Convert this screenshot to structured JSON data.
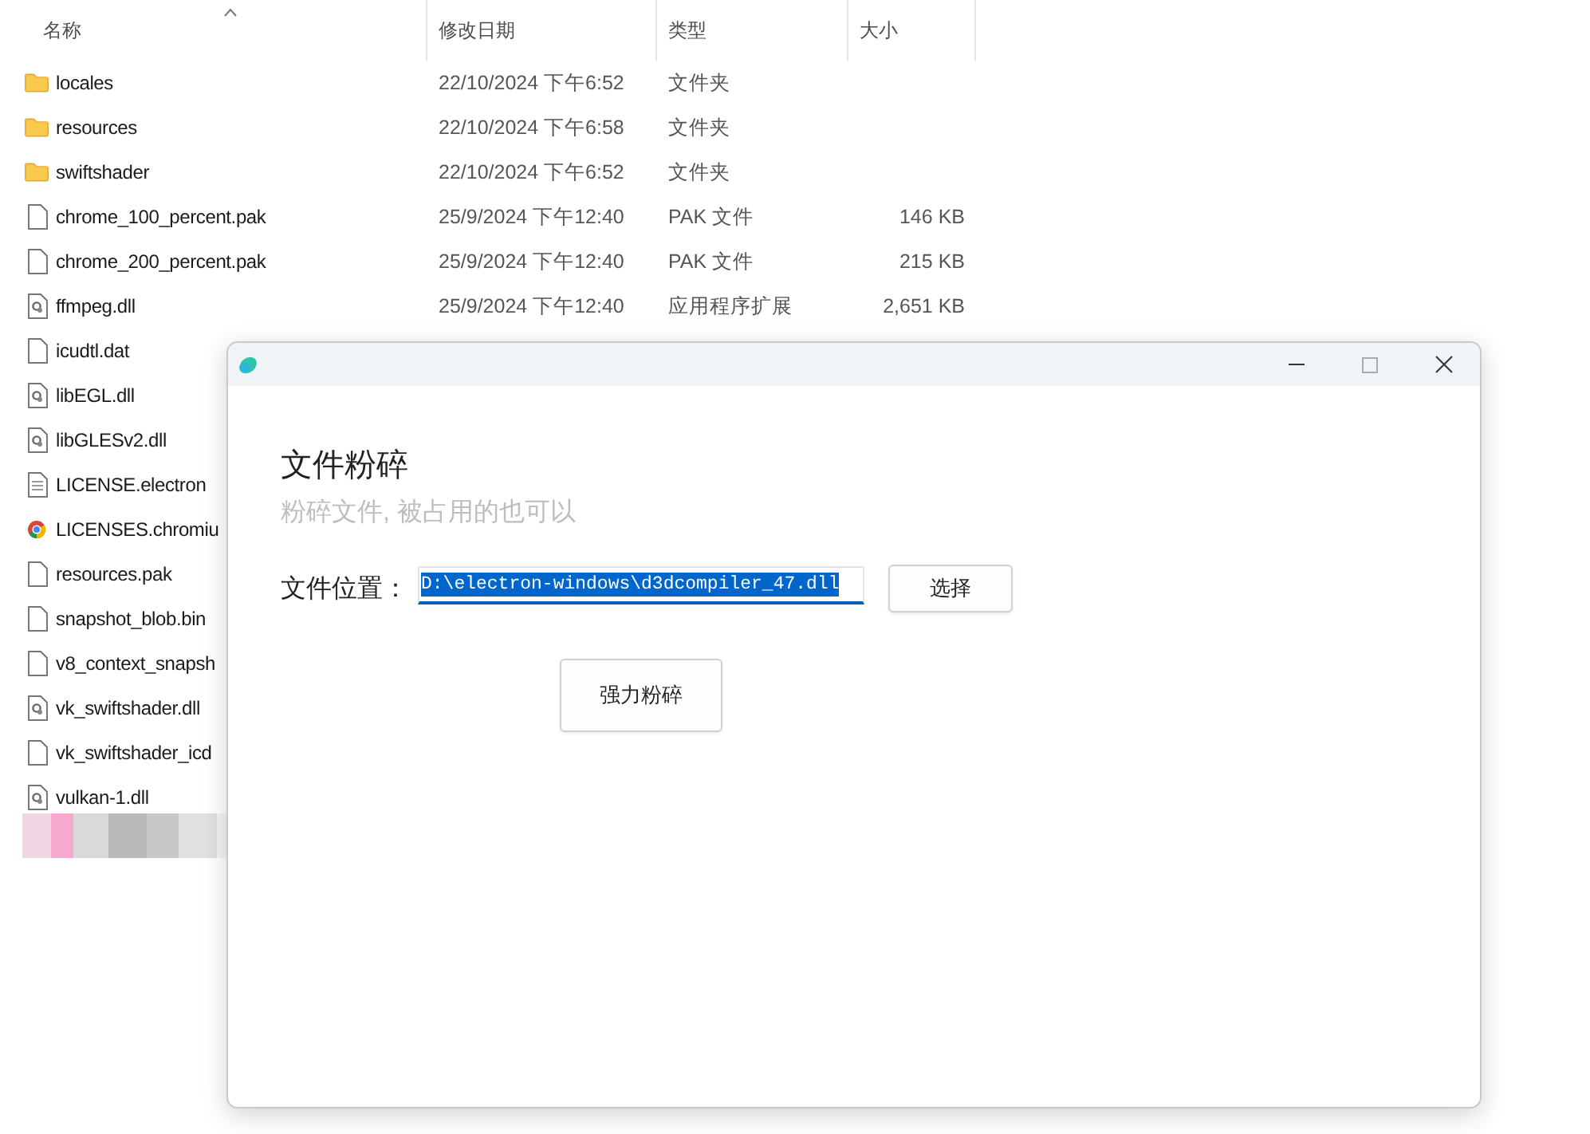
{
  "explorer": {
    "columns": [
      "名称",
      "修改日期",
      "类型",
      "大小"
    ],
    "rows": [
      {
        "kind": "folder",
        "name": "locales",
        "date": "22/10/2024 下午6:52",
        "type": "文件夹",
        "size": ""
      },
      {
        "kind": "folder",
        "name": "resources",
        "date": "22/10/2024 下午6:58",
        "type": "文件夹",
        "size": ""
      },
      {
        "kind": "folder",
        "name": "swiftshader",
        "date": "22/10/2024 下午6:52",
        "type": "文件夹",
        "size": ""
      },
      {
        "kind": "file",
        "name": "chrome_100_percent.pak",
        "date": "25/9/2024 下午12:40",
        "type": "PAK 文件",
        "size": "146 KB"
      },
      {
        "kind": "file",
        "name": "chrome_200_percent.pak",
        "date": "25/9/2024 下午12:40",
        "type": "PAK 文件",
        "size": "215 KB"
      },
      {
        "kind": "dll",
        "name": "ffmpeg.dll",
        "date": "25/9/2024 下午12:40",
        "type": "应用程序扩展",
        "size": "2,651 KB"
      },
      {
        "kind": "file",
        "name": "icudtl.dat"
      },
      {
        "kind": "dll",
        "name": "libEGL.dll"
      },
      {
        "kind": "dll",
        "name": "libGLESv2.dll"
      },
      {
        "kind": "text",
        "name": "LICENSE.electron"
      },
      {
        "kind": "chrome",
        "name": "LICENSES.chromiu"
      },
      {
        "kind": "file",
        "name": "resources.pak"
      },
      {
        "kind": "file",
        "name": "snapshot_blob.bin"
      },
      {
        "kind": "file",
        "name": "v8_context_snapsh"
      },
      {
        "kind": "dll",
        "name": "vk_swiftshader.dll"
      },
      {
        "kind": "file",
        "name": "vk_swiftshader_icd"
      },
      {
        "kind": "dll",
        "name": "vulkan-1.dll"
      }
    ]
  },
  "dialog": {
    "title": "文件粉碎",
    "subtitle": "粉碎文件, 被占用的也可以",
    "field_label": "文件位置：",
    "field_value": "D:\\electron-windows\\d3dcompiler_47.dll",
    "text_selected": true,
    "choose_button": "选择",
    "shred_button": "强力粉碎"
  }
}
